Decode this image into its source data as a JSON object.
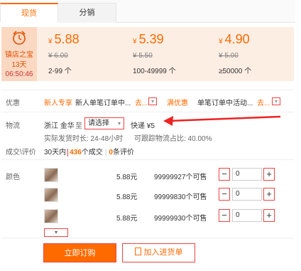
{
  "tabs": [
    {
      "label": "现货",
      "active": true
    },
    {
      "label": "分销",
      "active": false
    }
  ],
  "shop": {
    "line1": "镇店之宝",
    "line2": "13天",
    "line3": "06:50:46",
    "icon": "alarm-clock-icon"
  },
  "tiers": [
    {
      "currency": "¥",
      "price": "5.88",
      "old": "¥ 6.00",
      "range": "2-99 个"
    },
    {
      "currency": "¥",
      "price": "5.39",
      "old": "¥ 5.50",
      "range": "100-49999 个"
    },
    {
      "currency": "¥",
      "price": "4.90",
      "old": "¥ 5.00",
      "range": "≥50000 个"
    }
  ],
  "promo": {
    "label": "优惠",
    "badge1": "新人专享",
    "text1": "新人单笔订单中...",
    "more1": "去...",
    "badge2": "满优惠",
    "text2": "单笔订单中活动...",
    "more2": "去..."
  },
  "logistics": {
    "label": "物流",
    "origin": "浙江 金华",
    "to": "至",
    "select_placeholder": "请选择",
    "express": "快递 ¥5",
    "delivery": "实际发货时长: 24-48小时",
    "trackable": "可跟踪物流占比: 40.00%"
  },
  "reviews": {
    "label": "成交\\评价",
    "days": "30天内",
    "deals_count": "436",
    "deals_label": "个成交",
    "review_count": "0",
    "review_label": "条评价"
  },
  "sku": {
    "label": "颜色",
    "items": [
      {
        "price": "5.88元",
        "stock": "99999927个可售",
        "qty": "0"
      },
      {
        "price": "5.88元",
        "stock": "99999830个可售",
        "qty": "0"
      },
      {
        "price": "5.88元",
        "stock": "99999930个可售",
        "qty": "0"
      }
    ],
    "minus": "−",
    "plus": "+"
  },
  "actions": {
    "order": "立即订购",
    "cart": "加入进货单"
  },
  "colors": {
    "accent": "#ff6a00",
    "panel": "#fdeee4",
    "highlight_border": "#e44444"
  }
}
